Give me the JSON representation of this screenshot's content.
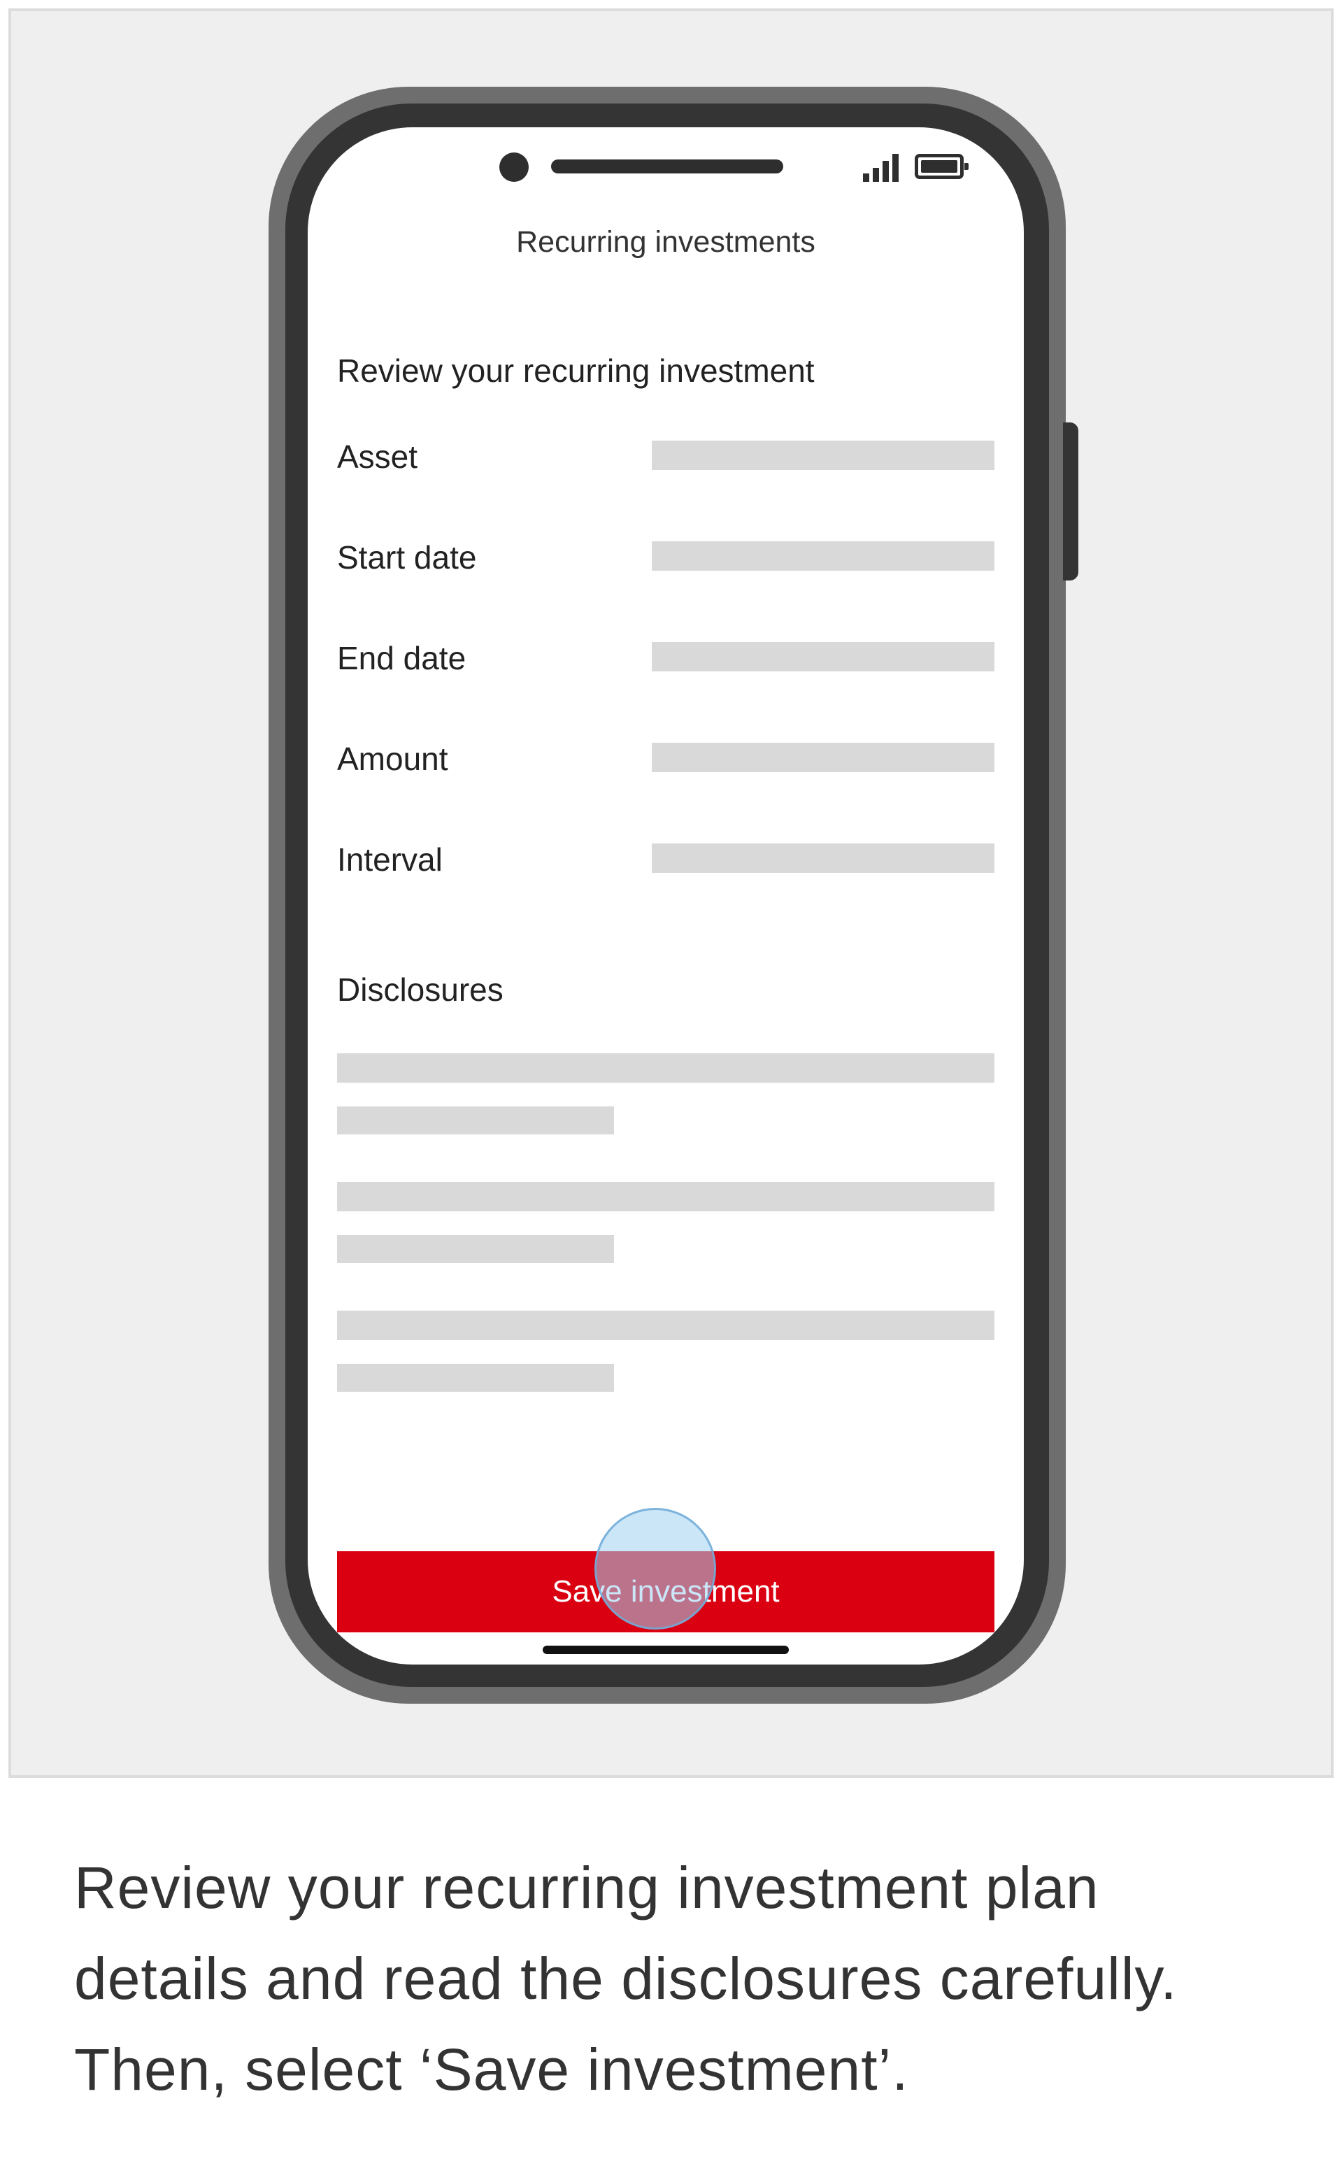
{
  "screen": {
    "app_title": "Recurring investments",
    "review_heading": "Review your recurring investment",
    "details": [
      {
        "label": "Asset"
      },
      {
        "label": "Start date"
      },
      {
        "label": "End date"
      },
      {
        "label": "Amount"
      },
      {
        "label": "Interval"
      }
    ],
    "disclosures_heading": "Disclosures",
    "save_button_label": "Save investment"
  },
  "caption": "Review your recurring investment plan details and read the disclosures carefully. Then, select ‘Save investment’.",
  "icons": [
    "camera-icon",
    "signal-strength-icon",
    "battery-icon"
  ],
  "colors": {
    "accent": "#db0011",
    "placeholder": "#d9d9d9",
    "panel_background": "#efefef",
    "phone_frame": "#343434"
  }
}
